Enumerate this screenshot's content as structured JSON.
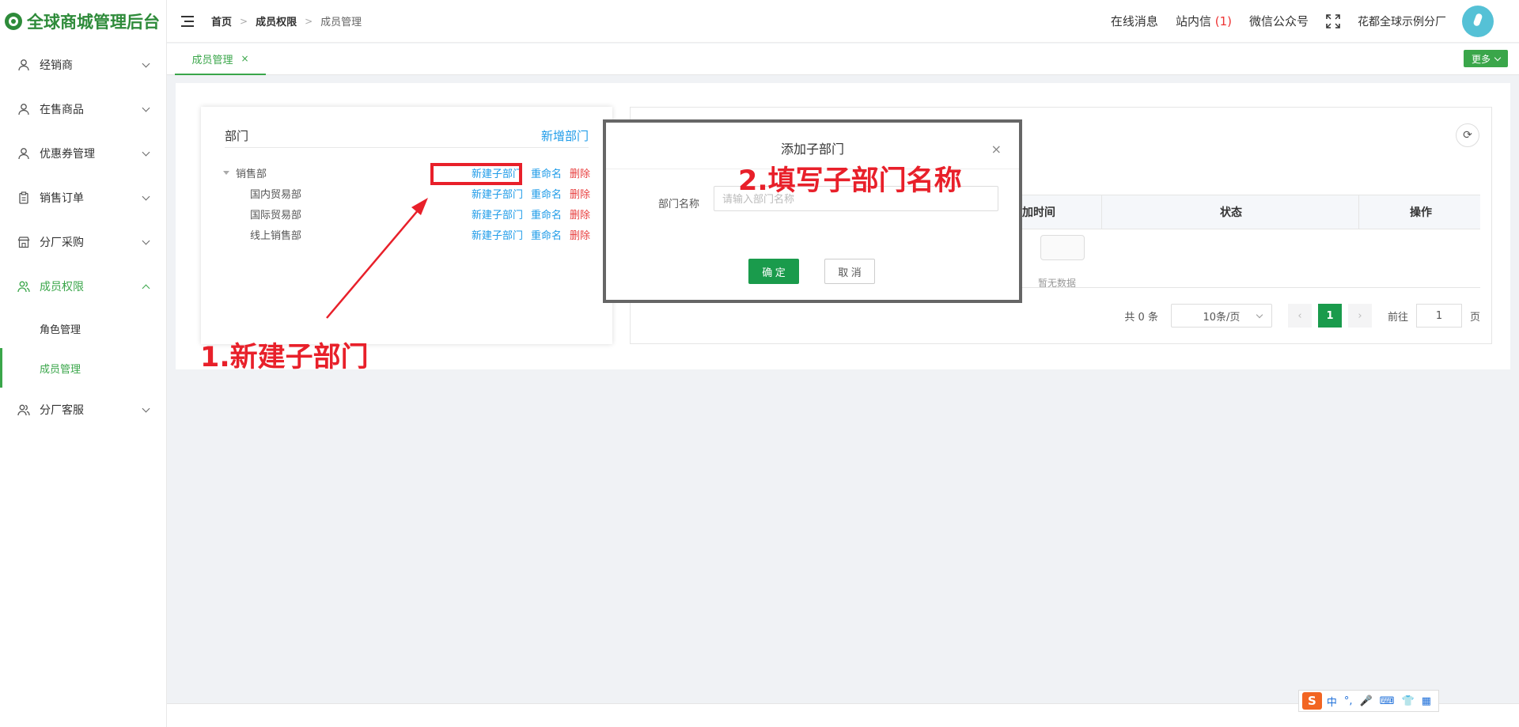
{
  "app": {
    "logo_text": "全球商城管理后台"
  },
  "sidebar": {
    "items": [
      {
        "label": "经销商",
        "icon": "user-icon"
      },
      {
        "label": "在售商品",
        "icon": "user-icon"
      },
      {
        "label": "优惠券管理",
        "icon": "user-icon"
      },
      {
        "label": "销售订单",
        "icon": "clipboard-icon"
      },
      {
        "label": "分厂采购",
        "icon": "store-icon"
      },
      {
        "label": "成员权限",
        "icon": "users-icon",
        "expanded": true
      },
      {
        "label": "分厂客服",
        "icon": "users-icon"
      }
    ],
    "sub_items": [
      {
        "label": "角色管理"
      },
      {
        "label": "成员管理",
        "active": true
      }
    ]
  },
  "header": {
    "breadcrumb": [
      "首页",
      "成员权限",
      "成员管理"
    ],
    "online_msg": "在线消息",
    "inbox": "站内信",
    "inbox_count": "(1)",
    "wechat": "微信公众号",
    "shop_name": "花都全球示例分厂"
  },
  "tabs": {
    "active_tab": "成员管理",
    "close": "×",
    "more": "更多"
  },
  "dept_panel": {
    "title": "部门",
    "add": "新增部门",
    "tree": [
      {
        "name": "销售部",
        "level": 0
      },
      {
        "name": "国内贸易部",
        "level": 1
      },
      {
        "name": "国际贸易部",
        "level": 1
      },
      {
        "name": "线上销售部",
        "level": 1
      }
    ],
    "actions": {
      "new_child": "新建子部门",
      "rename": "重命名",
      "delete": "删除"
    }
  },
  "member_table": {
    "columns": [
      "加时间",
      "状态",
      "操作"
    ],
    "empty_text": "暂无数据"
  },
  "pagination": {
    "total": "共 0 条",
    "page_size": "10条/页",
    "prev": "‹",
    "current": "1",
    "next": "›",
    "goto_label": "前往",
    "goto_value": "1",
    "page_unit": "页"
  },
  "dialog": {
    "title": "添加子部门",
    "close": "×",
    "field_label": "部门名称",
    "placeholder": "请输入部门名称",
    "ok": "确 定",
    "cancel": "取 消"
  },
  "annotations": {
    "step1": "1.新建子部门",
    "step2": "2.填写子部门名称",
    "color": "#e8202a"
  },
  "ime": {
    "logo": "S",
    "lang": "中",
    "punct": "°,",
    "mic": "🎤",
    "kbd": "⌨",
    "skin": "👕",
    "grid": "▦"
  },
  "colors": {
    "primary": "#3aa64a",
    "link": "#1e9be8",
    "danger": "#e84040",
    "button": "#1a9b4c"
  }
}
